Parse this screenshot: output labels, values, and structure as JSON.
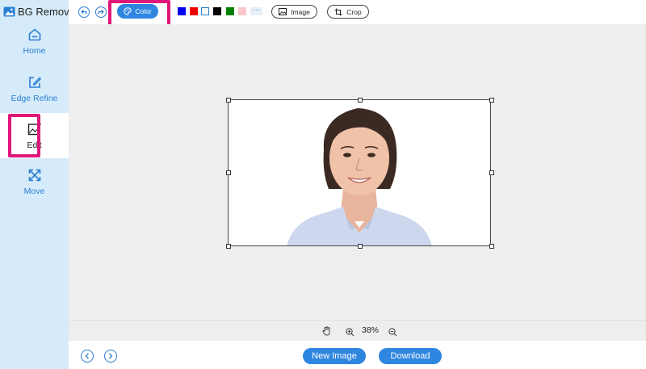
{
  "app": {
    "title": "BG Remover"
  },
  "sidebar": {
    "items": [
      {
        "label": "Home",
        "icon": "home-icon"
      },
      {
        "label": "Edge Refine",
        "icon": "edit-square-icon"
      },
      {
        "label": "Edit",
        "icon": "image-edit-icon",
        "active": true
      },
      {
        "label": "Move",
        "icon": "move-arrows-icon"
      }
    ]
  },
  "toolbar": {
    "color_label": "Color",
    "more_label": "···",
    "image_label": "Image",
    "crop_label": "Crop",
    "swatches": [
      "#0000ee",
      "#ee0000",
      "#ffffff",
      "#000000",
      "#008000",
      "#f7c7cc"
    ]
  },
  "zoom": {
    "value": "38%"
  },
  "bottom": {
    "new_image_label": "New Image",
    "download_label": "Download"
  },
  "colors": {
    "accent": "#2f86e0",
    "highlight": "#e0177a",
    "sidebar_bg": "#d6ebfa"
  }
}
